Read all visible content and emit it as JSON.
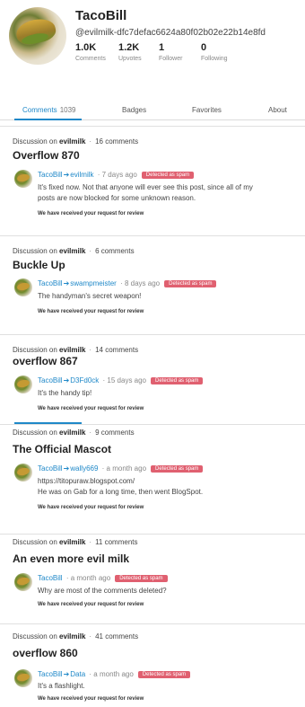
{
  "profile": {
    "username": "TacoBill",
    "handle": "@evilmilk-dfc7defac6624a80f02b02e22b14e8fd",
    "stats": [
      {
        "value": "1.0K",
        "label": "Comments"
      },
      {
        "value": "1.2K",
        "label": "Upvotes"
      },
      {
        "value": "1",
        "label": "Follower"
      },
      {
        "value": "0",
        "label": "Following"
      }
    ]
  },
  "tabs": [
    {
      "label": "Comments",
      "count": "1039"
    },
    {
      "label": "Badges"
    },
    {
      "label": "Favorites"
    },
    {
      "label": "About"
    }
  ],
  "colors": {
    "accent": "#1f88c8",
    "spam": "#e06070"
  },
  "cards": [
    {
      "discussion_prefix": "Discussion on",
      "community": "evilmilk",
      "comment_count": "16 comments",
      "title": "Overflow 870",
      "author": "TacoBill",
      "reply_to": "evilmilk",
      "time": "· 7 days ago",
      "spam_label": "Detected as spam",
      "body": [
        "It's fixed now. Not that anyone will ever see this post, since all of my",
        "posts are now blocked for some unknown reason."
      ],
      "review_text": "We have received your request for review"
    },
    {
      "discussion_prefix": "Discussion on",
      "community": "evilmilk",
      "comment_count": "6 comments",
      "title": "Buckle Up",
      "author": "TacoBill",
      "reply_to": "swampmeister",
      "time": "· 8 days ago",
      "spam_label": "Detected as spam",
      "body": [
        "The handyman's secret weapon!"
      ],
      "review_text": "We have received your request for review"
    },
    {
      "discussion_prefix": "Discussion on",
      "community": "evilmilk",
      "comment_count": "14 comments",
      "title": "overflow 867",
      "author": "TacoBill",
      "reply_to": "D3Fd0ck",
      "time": "· 15 days ago",
      "spam_label": "Detected as spam",
      "body": [
        "It's the handy tip!"
      ],
      "review_text": "We have received your request for review"
    },
    {
      "discussion_prefix": "Discussion on",
      "community": "evilmilk",
      "comment_count": "9 comments",
      "title": "The Official Mascot",
      "author": "TacoBill",
      "reply_to": "wally669",
      "time": "· a month ago",
      "spam_label": "Detected as spam",
      "body": [
        "https://titopuraw.blogspot.com/",
        "He was on Gab for a long time, then went BlogSpot."
      ],
      "review_text": "We have received your request for review"
    },
    {
      "discussion_prefix": "Discussion on",
      "community": "evilmilk",
      "comment_count": "11 comments",
      "title": "An even more evil milk",
      "author": "TacoBill",
      "reply_to": "",
      "time": "· a month ago",
      "spam_label": "Detected as spam",
      "body": [
        "Why are most of the comments deleted?"
      ],
      "review_text": "We have received your request for review"
    },
    {
      "discussion_prefix": "Discussion on",
      "community": "evilmilk",
      "comment_count": "41 comments",
      "title": "overflow 860",
      "author": "TacoBill",
      "reply_to": "Data",
      "time": "· a month ago",
      "spam_label": "Detected as spam",
      "body": [
        "It's a flashlight."
      ],
      "review_text": "We have received your request for review"
    }
  ]
}
